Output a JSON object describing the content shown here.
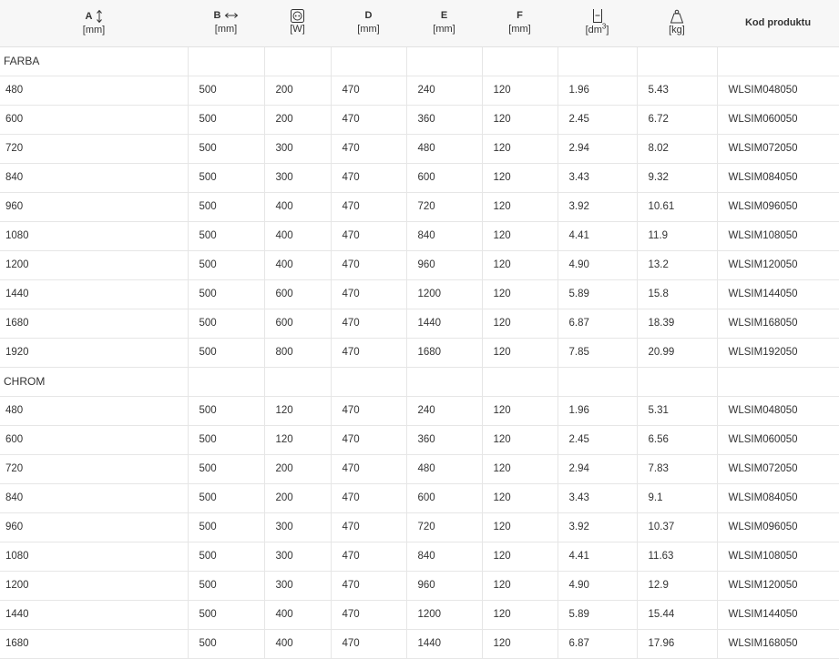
{
  "header": {
    "a": {
      "label": "A",
      "unit": "[mm]",
      "icon": "vertical-arrow-icon"
    },
    "b": {
      "label": "B",
      "unit": "[mm]",
      "icon": "horizontal-arrow-icon"
    },
    "w": {
      "label": "",
      "unit": "[W]",
      "icon": "heating-power-icon"
    },
    "d": {
      "label": "D",
      "unit": "[mm]"
    },
    "e": {
      "label": "E",
      "unit": "[mm]"
    },
    "f": {
      "label": "F",
      "unit": "[mm]"
    },
    "vol": {
      "label": "",
      "unit": "[dm",
      "unit_sup": "3",
      "unit_end": "]",
      "icon": "water-volume-icon"
    },
    "kg": {
      "label": "",
      "unit": "[kg]",
      "icon": "weight-icon"
    },
    "code": {
      "label": "Kod produktu"
    }
  },
  "groups": [
    {
      "name": "FARBA",
      "rows": [
        [
          "480",
          "500",
          "200",
          "470",
          "240",
          "120",
          "1.96",
          "5.43",
          "WLSIM048050"
        ],
        [
          "600",
          "500",
          "200",
          "470",
          "360",
          "120",
          "2.45",
          "6.72",
          "WLSIM060050"
        ],
        [
          "720",
          "500",
          "300",
          "470",
          "480",
          "120",
          "2.94",
          "8.02",
          "WLSIM072050"
        ],
        [
          "840",
          "500",
          "300",
          "470",
          "600",
          "120",
          "3.43",
          "9.32",
          "WLSIM084050"
        ],
        [
          "960",
          "500",
          "400",
          "470",
          "720",
          "120",
          "3.92",
          "10.61",
          "WLSIM096050"
        ],
        [
          "1080",
          "500",
          "400",
          "470",
          "840",
          "120",
          "4.41",
          "11.9",
          "WLSIM108050"
        ],
        [
          "1200",
          "500",
          "400",
          "470",
          "960",
          "120",
          "4.90",
          "13.2",
          "WLSIM120050"
        ],
        [
          "1440",
          "500",
          "600",
          "470",
          "1200",
          "120",
          "5.89",
          "15.8",
          "WLSIM144050"
        ],
        [
          "1680",
          "500",
          "600",
          "470",
          "1440",
          "120",
          "6.87",
          "18.39",
          "WLSIM168050"
        ],
        [
          "1920",
          "500",
          "800",
          "470",
          "1680",
          "120",
          "7.85",
          "20.99",
          "WLSIM192050"
        ]
      ]
    },
    {
      "name": "CHROM",
      "rows": [
        [
          "480",
          "500",
          "120",
          "470",
          "240",
          "120",
          "1.96",
          "5.31",
          "WLSIM048050"
        ],
        [
          "600",
          "500",
          "120",
          "470",
          "360",
          "120",
          "2.45",
          "6.56",
          "WLSIM060050"
        ],
        [
          "720",
          "500",
          "200",
          "470",
          "480",
          "120",
          "2.94",
          "7.83",
          "WLSIM072050"
        ],
        [
          "840",
          "500",
          "200",
          "470",
          "600",
          "120",
          "3.43",
          "9.1",
          "WLSIM084050"
        ],
        [
          "960",
          "500",
          "300",
          "470",
          "720",
          "120",
          "3.92",
          "10.37",
          "WLSIM096050"
        ],
        [
          "1080",
          "500",
          "300",
          "470",
          "840",
          "120",
          "4.41",
          "11.63",
          "WLSIM108050"
        ],
        [
          "1200",
          "500",
          "300",
          "470",
          "960",
          "120",
          "4.90",
          "12.9",
          "WLSIM120050"
        ],
        [
          "1440",
          "500",
          "400",
          "470",
          "1200",
          "120",
          "5.89",
          "15.44",
          "WLSIM144050"
        ],
        [
          "1680",
          "500",
          "400",
          "470",
          "1440",
          "120",
          "6.87",
          "17.96",
          "WLSIM168050"
        ]
      ]
    }
  ]
}
